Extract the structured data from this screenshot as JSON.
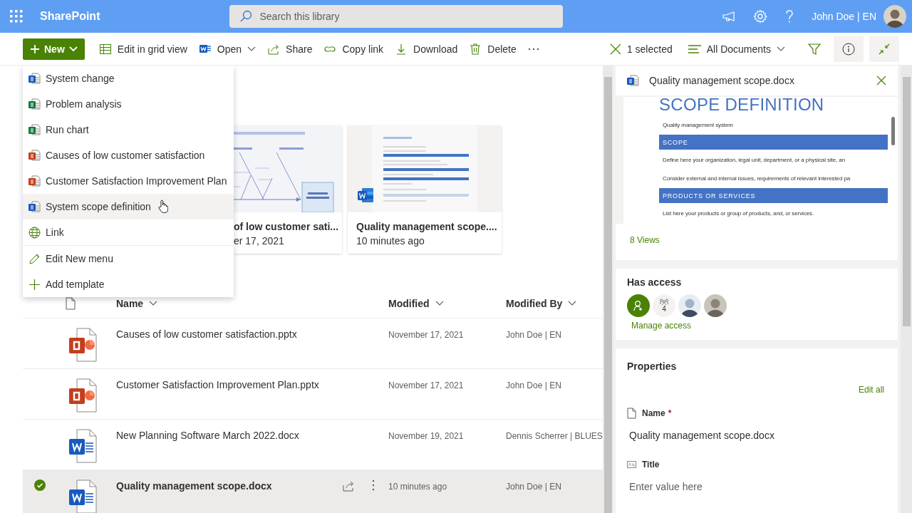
{
  "app": {
    "name": "SharePoint",
    "search_placeholder": "Search this library",
    "user": "John Doe | EN"
  },
  "command_bar": {
    "new_button": "New",
    "commands": [
      {
        "label": "Edit in grid view",
        "kind": "grid"
      },
      {
        "label": "Open",
        "kind": "open"
      },
      {
        "label": "Share",
        "kind": "share"
      },
      {
        "label": "Copy link",
        "kind": "link"
      },
      {
        "label": "Download",
        "kind": "download"
      },
      {
        "label": "Delete",
        "kind": "delete"
      }
    ],
    "selection": "1 selected",
    "view": "All Documents"
  },
  "new_menu": {
    "items": [
      {
        "label": "System change",
        "kind": "word",
        "selected": false
      },
      {
        "label": "Problem analysis",
        "kind": "excel",
        "selected": false
      },
      {
        "label": "Run chart",
        "kind": "excel",
        "selected": false
      },
      {
        "label": "Causes of low customer satisfaction",
        "kind": "powerpoint",
        "selected": false
      },
      {
        "label": "Customer Satisfaction Improvement Plan",
        "kind": "powerpoint",
        "selected": false
      },
      {
        "label": "System scope definition",
        "kind": "word",
        "selected": true
      },
      {
        "label": "Link",
        "kind": "link",
        "selected": false
      },
      {
        "label": "Edit New menu",
        "kind": "edit",
        "selected": false
      },
      {
        "label": "Add template",
        "kind": "add",
        "selected": false
      }
    ]
  },
  "cards": [
    {
      "kind": "fishbone",
      "title": "of low customer sati...",
      "subtitle": "er 17, 2021"
    },
    {
      "kind": "document",
      "title": "Quality management scope....",
      "subtitle": "10 minutes ago"
    }
  ],
  "table": {
    "columns": [
      {
        "label": "Name"
      },
      {
        "label": "Modified"
      },
      {
        "label": "Modified By"
      }
    ],
    "rows": [
      {
        "name": "Causes of low customer satisfaction.pptx",
        "kind": "powerpoint",
        "modified": "November 17, 2021",
        "modified_by": "John Doe | EN",
        "selected": false
      },
      {
        "name": "Customer Satisfaction Improvement Plan.pptx",
        "kind": "powerpoint",
        "modified": "November 17, 2021",
        "modified_by": "John Doe | EN",
        "selected": false
      },
      {
        "name": "New Planning Software March 2022.docx",
        "kind": "word",
        "modified": "November 19, 2021",
        "modified_by": "Dennis Scherrer | BLUES",
        "selected": false
      },
      {
        "name": "Quality management scope.docx",
        "kind": "word",
        "modified": "10 minutes ago",
        "modified_by": "John Doe | EN",
        "selected": true
      }
    ]
  },
  "details": {
    "file_name": "Quality management scope.docx",
    "preview": {
      "heading": "SCOPE DEFINITION",
      "subtitle": "Quality management system",
      "sections": [
        {
          "heading": "SCOPE",
          "lines": [
            "Define here your organization, legal unit, department, or a physical site, an",
            "Consider external and internal issues, requirements of relevant interested pa"
          ]
        },
        {
          "heading": "PRODUCTS OR SERVICES",
          "lines": [
            "List here your products or group of products, and, or services."
          ]
        }
      ]
    },
    "views": "8 Views",
    "access": {
      "title": "Has access",
      "group_count": "4",
      "link": "Manage access"
    },
    "properties": {
      "title": "Properties",
      "edit_all": "Edit all",
      "fields": [
        {
          "label": "Name",
          "required_mark": "*",
          "kind": "file",
          "value": "Quality management scope.docx"
        },
        {
          "label": "Title",
          "kind": "text",
          "placeholder": "Enter value here"
        }
      ]
    }
  }
}
